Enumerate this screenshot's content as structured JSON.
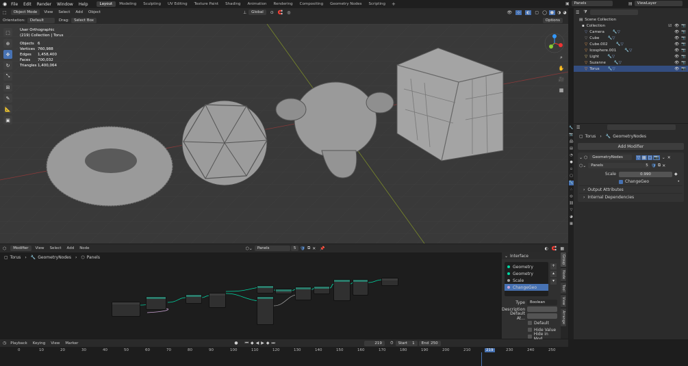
{
  "topbar": {
    "menus": [
      "File",
      "Edit",
      "Render",
      "Window",
      "Help"
    ],
    "workspaces": [
      "Layout",
      "Modeling",
      "Sculpting",
      "UV Editing",
      "Texture Paint",
      "Shading",
      "Animation",
      "Rendering",
      "Compositing",
      "Geometry Nodes",
      "Scripting"
    ],
    "active_workspace": "Layout",
    "scene": "Panels",
    "view_layer": "ViewLayer"
  },
  "viewport": {
    "mode": "Object Mode",
    "menus": [
      "View",
      "Select",
      "Add",
      "Object"
    ],
    "transform_orientation": "Global",
    "orientation_label": "Orientation:",
    "orientation_value": "Default",
    "drag_label": "Drag:",
    "drag_value": "Select Box",
    "options_label": "Options",
    "view_name": "User Orthographic",
    "collection_info": "(219) Collection | Torus",
    "stats": [
      {
        "k": "Objects",
        "v": "6"
      },
      {
        "k": "Vertices",
        "v": "760,988"
      },
      {
        "k": "Edges",
        "v": "1,458,400"
      },
      {
        "k": "Faces",
        "v": "700,032"
      },
      {
        "k": "Triangles",
        "v": "1,400,064"
      }
    ]
  },
  "outliner": {
    "root": "Scene Collection",
    "collection": "Collection",
    "items": [
      {
        "name": "Camera",
        "color": "#7a8fc0"
      },
      {
        "name": "Cube",
        "color": "#888888"
      },
      {
        "name": "Cube.002",
        "color": "#f0a050"
      },
      {
        "name": "Icosphere.001",
        "color": "#f0a050"
      },
      {
        "name": "Light",
        "color": "#e8d080"
      },
      {
        "name": "Suzanne",
        "color": "#f0a050"
      },
      {
        "name": "Torus",
        "color": "#f0a050"
      }
    ]
  },
  "properties": {
    "breadcrumb_object": "Torus",
    "breadcrumb_modifier": "GeometryNodes",
    "add_modifier": "Add Modifier",
    "modifier_name": "GeometryNodes",
    "node_group": "Panels",
    "node_group_users": "5",
    "scale_label": "Scale",
    "scale_value": "0.990",
    "change_geo": "ChangeGeo",
    "output_attributes": "Output Attributes",
    "internal_dependencies": "Internal Dependencies"
  },
  "node_editor": {
    "editor_type": "Modifier",
    "menus": [
      "View",
      "Select",
      "Add",
      "Node"
    ],
    "node_group": "Panels",
    "users": "5",
    "breadcrumb": [
      "Torus",
      "GeometryNodes",
      "Panels"
    ]
  },
  "npanel": {
    "title": "Interface",
    "sockets": [
      {
        "label": "Geometry",
        "color": "#00d6a3",
        "active": false
      },
      {
        "label": "Geometry",
        "color": "#00d6a3",
        "active": false
      },
      {
        "label": "Scale",
        "color": "#a1a1a1",
        "active": false
      },
      {
        "label": "ChangeGeo",
        "color": "#cca6d6",
        "active": true
      }
    ],
    "type_label": "Type",
    "type_value": "Boolean",
    "description_label": "Description",
    "default_label": "Default At...",
    "default_check": "Default",
    "hide_value": "Hide Value",
    "hide_in_mod": "Hide in Mod...",
    "tabs": [
      "Group",
      "Node",
      "Tool",
      "View",
      "Arrange"
    ]
  },
  "timeline": {
    "menus": [
      "Playback",
      "Keying",
      "View",
      "Marker"
    ],
    "current_frame": "219",
    "start_label": "Start",
    "start_value": "1",
    "end_label": "End",
    "end_value": "250",
    "ticks": [
      "0",
      "10",
      "20",
      "30",
      "40",
      "50",
      "60",
      "70",
      "80",
      "90",
      "100",
      "110",
      "120",
      "130",
      "140",
      "150",
      "160",
      "170",
      "180",
      "190",
      "200",
      "210",
      "219",
      "230",
      "240",
      "250"
    ]
  }
}
